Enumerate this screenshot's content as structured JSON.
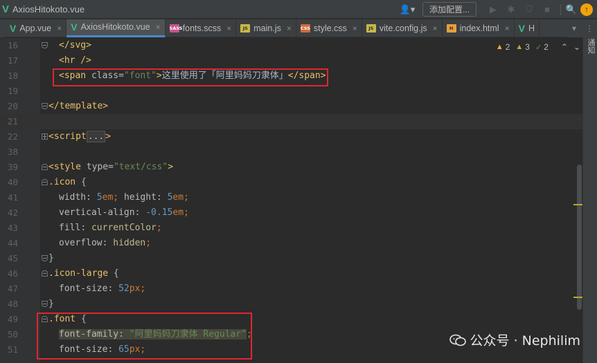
{
  "window": {
    "title": "AxiosHitokoto.vue",
    "logo_glyph": "V"
  },
  "toolbar": {
    "user_glyph": "👤▾",
    "add_config_label": "添加配置...",
    "run_glyph": "▶",
    "debug_glyph": "✱",
    "coverage_glyph": "⛉",
    "stop_glyph": "■",
    "search_glyph": "🔍",
    "update_glyph": "↑"
  },
  "tabs": [
    {
      "label": "App.vue",
      "icon": "V",
      "icon_type": "vue",
      "closable": true
    },
    {
      "label": "AxiosHitokoto.vue",
      "icon": "V",
      "icon_type": "vue",
      "closable": true,
      "active": true
    },
    {
      "label": "fonts.scss",
      "icon": "SASS",
      "icon_type": "sass",
      "closable": true
    },
    {
      "label": "main.js",
      "icon": "JS",
      "icon_type": "js",
      "closable": true
    },
    {
      "label": "style.css",
      "icon": "CSS",
      "icon_type": "css",
      "closable": true
    },
    {
      "label": "vite.config.js",
      "icon": "JS",
      "icon_type": "js",
      "closable": true
    },
    {
      "label": "index.html",
      "icon": "H",
      "icon_type": "html",
      "closable": true
    },
    {
      "label": "H",
      "icon": "V",
      "icon_type": "vue",
      "closable": false
    }
  ],
  "tab_controls": {
    "dropdown_glyph": "▾",
    "more_glyph": "⋮"
  },
  "tool_window": {
    "notifications_label": "通知"
  },
  "inspections": {
    "warnings": "2",
    "weak_warnings": "3",
    "ok": "2",
    "warn_glyph": "▲",
    "weak_glyph": "▲",
    "ok_glyph": "✓",
    "up_glyph": "⌃",
    "down_glyph": "⌄"
  },
  "lines": [
    {
      "num": "16",
      "code": [
        [
          "tg",
          "</svg>"
        ]
      ],
      "indent": 1,
      "fold": "end"
    },
    {
      "num": "17",
      "code": [
        [
          "tg",
          "<hr />"
        ]
      ],
      "indent": 1
    },
    {
      "num": "18",
      "code": [
        [
          "tg",
          "<span "
        ],
        [
          "at",
          "class="
        ],
        [
          "sv",
          "\"font\""
        ],
        [
          "tg",
          ">"
        ],
        [
          "tx",
          "这里使用了「阿里妈妈刀隶体」"
        ],
        [
          "tg",
          "</span>"
        ]
      ],
      "indent": 1
    },
    {
      "num": "19",
      "code": [],
      "indent": 0
    },
    {
      "num": "20",
      "code": [
        [
          "tg",
          "</template>"
        ]
      ],
      "indent": 0,
      "fold": "end"
    },
    {
      "num": "21",
      "code": [],
      "indent": 0,
      "current": true
    },
    {
      "num": "22",
      "code": [
        [
          "tg",
          "<script"
        ],
        [
          "fold-cl",
          "..."
        ],
        [
          "tg",
          ">"
        ]
      ],
      "indent": 0,
      "fold": "plus"
    },
    {
      "num": "38",
      "code": [],
      "indent": 0
    },
    {
      "num": "39",
      "code": [
        [
          "tg",
          "<style "
        ],
        [
          "at",
          "type="
        ],
        [
          "sv",
          "\"text/css\""
        ],
        [
          "tg",
          ">"
        ]
      ],
      "indent": 0,
      "fold": "start"
    },
    {
      "num": "40",
      "code": [
        [
          "cl",
          ".icon "
        ],
        [
          "pl",
          "{"
        ]
      ],
      "indent": 0,
      "fold": "start"
    },
    {
      "num": "41",
      "code": [
        [
          "pr",
          "width"
        ],
        [
          "pl",
          ": "
        ],
        [
          "nm",
          "5"
        ],
        [
          "un",
          "em"
        ],
        [
          "kw",
          "; "
        ],
        [
          "pr",
          "height"
        ],
        [
          "pl",
          ": "
        ],
        [
          "nm",
          "5"
        ],
        [
          "un",
          "em"
        ],
        [
          "kw",
          ";"
        ]
      ],
      "indent": 1
    },
    {
      "num": "42",
      "code": [
        [
          "pr",
          "vertical-align"
        ],
        [
          "pl",
          ": "
        ],
        [
          "nm",
          "-0.15"
        ],
        [
          "un",
          "em"
        ],
        [
          "kw",
          ";"
        ]
      ],
      "indent": 1
    },
    {
      "num": "43",
      "code": [
        [
          "pr",
          "fill"
        ],
        [
          "pl",
          ": "
        ],
        [
          "vl",
          "currentColor"
        ],
        [
          "kw",
          ";"
        ]
      ],
      "indent": 1
    },
    {
      "num": "44",
      "code": [
        [
          "pr",
          "overflow"
        ],
        [
          "pl",
          ": "
        ],
        [
          "vl",
          "hidden"
        ],
        [
          "kw",
          ";"
        ]
      ],
      "indent": 1
    },
    {
      "num": "45",
      "code": [
        [
          "pl",
          "}"
        ]
      ],
      "indent": 0,
      "fold": "end"
    },
    {
      "num": "46",
      "code": [
        [
          "cl",
          ".icon-large "
        ],
        [
          "pl",
          "{"
        ]
      ],
      "indent": 0,
      "fold": "start"
    },
    {
      "num": "47",
      "code": [
        [
          "pr",
          "font-size"
        ],
        [
          "pl",
          ": "
        ],
        [
          "nm",
          "52"
        ],
        [
          "un",
          "px"
        ],
        [
          "kw",
          ";"
        ]
      ],
      "indent": 1
    },
    {
      "num": "48",
      "code": [
        [
          "pl",
          "}"
        ]
      ],
      "indent": 0,
      "fold": "end"
    },
    {
      "num": "49",
      "code": [
        [
          "cl",
          ".font "
        ],
        [
          "pl",
          "{"
        ]
      ],
      "indent": 0,
      "fold": "start"
    },
    {
      "num": "50",
      "code": [
        [
          "pr hl",
          "font-family"
        ],
        [
          "pl hl",
          ": "
        ],
        [
          "sv hl",
          "\"阿里妈妈刀隶体 Regular\""
        ],
        [
          "kw",
          ";"
        ]
      ],
      "indent": 1
    },
    {
      "num": "51",
      "code": [
        [
          "pr",
          "font-size"
        ],
        [
          "pl",
          ": "
        ],
        [
          "nm",
          "65"
        ],
        [
          "un",
          "px"
        ],
        [
          "kw",
          ";"
        ]
      ],
      "indent": 1
    }
  ],
  "watermark": {
    "text": "公众号 · Nephilim"
  }
}
